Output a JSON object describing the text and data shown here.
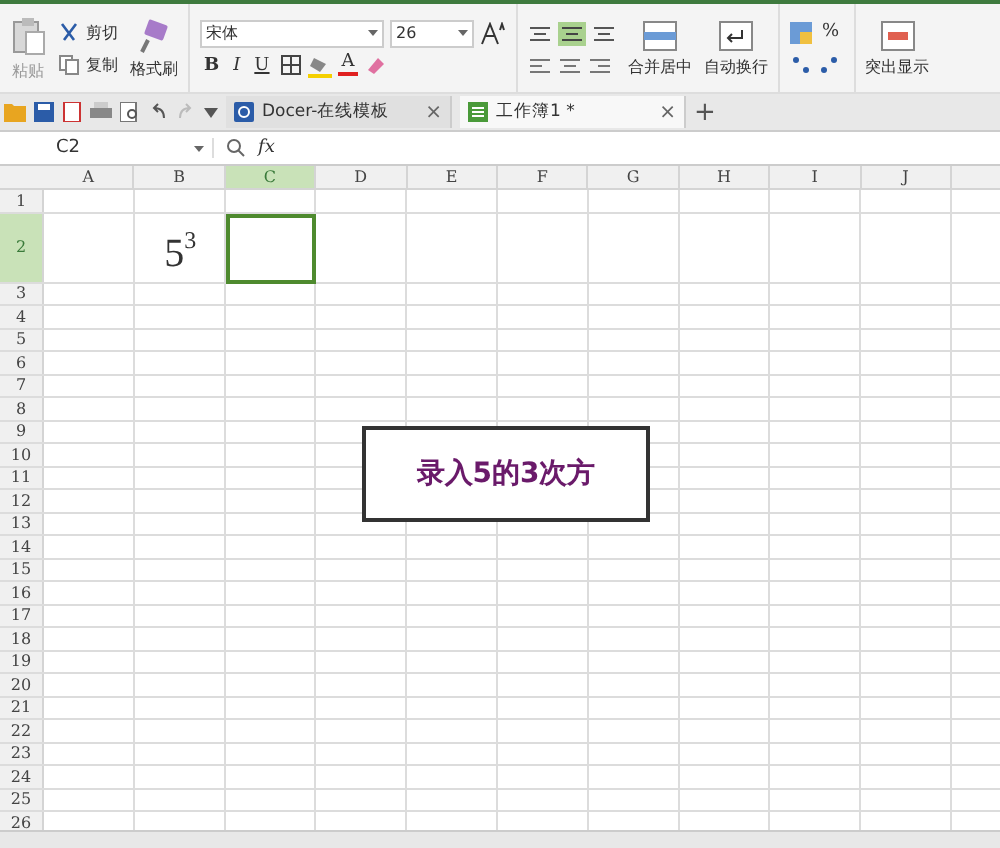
{
  "ribbon": {
    "clipboard": {
      "paste": "粘贴",
      "cut": "剪切",
      "copy": "复制",
      "format_painter": "格式刷"
    },
    "font": {
      "name": "宋体",
      "size": "26",
      "bold": "B",
      "italic": "I",
      "underline": "U",
      "font_color": "A"
    },
    "alignment": {
      "merge": "合并居中",
      "wrap": "自动换行"
    },
    "number": {
      "percent": "%"
    },
    "styles": {
      "highlight": "突出显示"
    }
  },
  "doc_tabs": [
    {
      "label": "Docer-在线模板",
      "close": "×",
      "selected": false
    },
    {
      "label": "工作簿1 *",
      "close": "×",
      "selected": true
    }
  ],
  "new_tab": "+",
  "formula_bar": {
    "name_box": "C2",
    "fx": "fx"
  },
  "sheet": {
    "columns": [
      {
        "label": "A",
        "selected": false
      },
      {
        "label": "B",
        "selected": false
      },
      {
        "label": "C",
        "selected": true
      },
      {
        "label": "D",
        "selected": false
      },
      {
        "label": "E",
        "selected": false
      },
      {
        "label": "F",
        "selected": false
      },
      {
        "label": "G",
        "selected": false
      },
      {
        "label": "H",
        "selected": false
      },
      {
        "label": "I",
        "selected": false
      },
      {
        "label": "J",
        "selected": false
      }
    ],
    "rows": [
      {
        "label": "1",
        "selected": false
      },
      {
        "label": "2",
        "selected": true,
        "tall": true,
        "cells": [
          null,
          {
            "base": "5",
            "exponent": "3"
          }
        ]
      },
      {
        "label": "3",
        "selected": false
      },
      {
        "label": "4",
        "selected": false
      },
      {
        "label": "5",
        "selected": false
      },
      {
        "label": "6",
        "selected": false
      },
      {
        "label": "7",
        "selected": false
      },
      {
        "label": "8",
        "selected": false
      },
      {
        "label": "9",
        "selected": false
      },
      {
        "label": "10",
        "selected": false
      },
      {
        "label": "11",
        "selected": false
      },
      {
        "label": "12",
        "selected": false
      },
      {
        "label": "13",
        "selected": false
      },
      {
        "label": "14",
        "selected": false
      },
      {
        "label": "15",
        "selected": false
      },
      {
        "label": "16",
        "selected": false
      },
      {
        "label": "17",
        "selected": false
      },
      {
        "label": "18",
        "selected": false
      },
      {
        "label": "19",
        "selected": false
      },
      {
        "label": "20",
        "selected": false
      },
      {
        "label": "21",
        "selected": false
      },
      {
        "label": "22",
        "selected": false
      },
      {
        "label": "23",
        "selected": false
      },
      {
        "label": "24",
        "selected": false
      },
      {
        "label": "25",
        "selected": false
      },
      {
        "label": "26",
        "selected": false
      }
    ],
    "text_box": "录入5的3次方"
  }
}
